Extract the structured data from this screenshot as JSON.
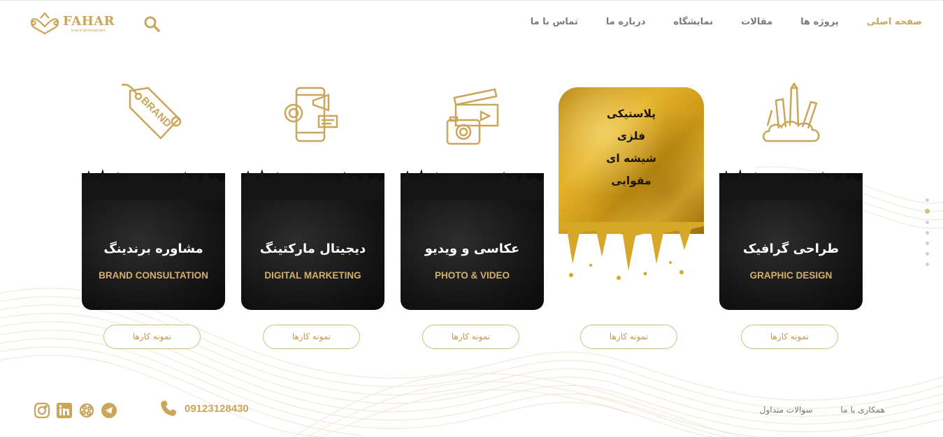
{
  "brand": {
    "name": "FAHAR",
    "tagline": "brand development",
    "accent": "#caa55a"
  },
  "nav": {
    "items": [
      {
        "label": "صفحه اصلی",
        "active": true
      },
      {
        "label": "پروژه ها",
        "active": false
      },
      {
        "label": "مقالات",
        "active": false
      },
      {
        "label": "نمایشگاه",
        "active": false
      },
      {
        "label": "درباره ما",
        "active": false
      },
      {
        "label": "تماس با ما",
        "active": false
      }
    ]
  },
  "cards": [
    {
      "title_fa": "طراحی گرافیک",
      "title_en": "GRAPHIC DESIGN",
      "icon": "design-tools-icon",
      "button": "نمونه کارها"
    },
    {
      "gold_lines": [
        "پلاستیکی",
        "فلزی",
        "شیشه ای",
        "مقوایی"
      ],
      "button": "نمونه کارها"
    },
    {
      "title_fa": "عکاسی و ویدیو",
      "title_en": "PHOTO & VIDEO",
      "icon": "camera-clapper-icon",
      "button": "نمونه کارها"
    },
    {
      "title_fa": "دیجیتال مارکتینگ",
      "title_en": "DIGITAL MARKETING",
      "icon": "digital-marketing-icon",
      "button": "نمونه کارها"
    },
    {
      "title_fa": "مشاوره برندینگ",
      "title_en": "BRAND CONSULTATION",
      "icon": "brand-tag-icon",
      "icon_text": "BRAND",
      "button": "نمونه کارها"
    }
  ],
  "footer": {
    "phone": "09123128430",
    "links": [
      "همکاری با ما",
      "سوالات متداول"
    ],
    "socials": [
      "instagram-icon",
      "linkedin-icon",
      "aparat-icon",
      "telegram-icon"
    ]
  },
  "side_dots": {
    "count": 7,
    "active_index": 1
  }
}
